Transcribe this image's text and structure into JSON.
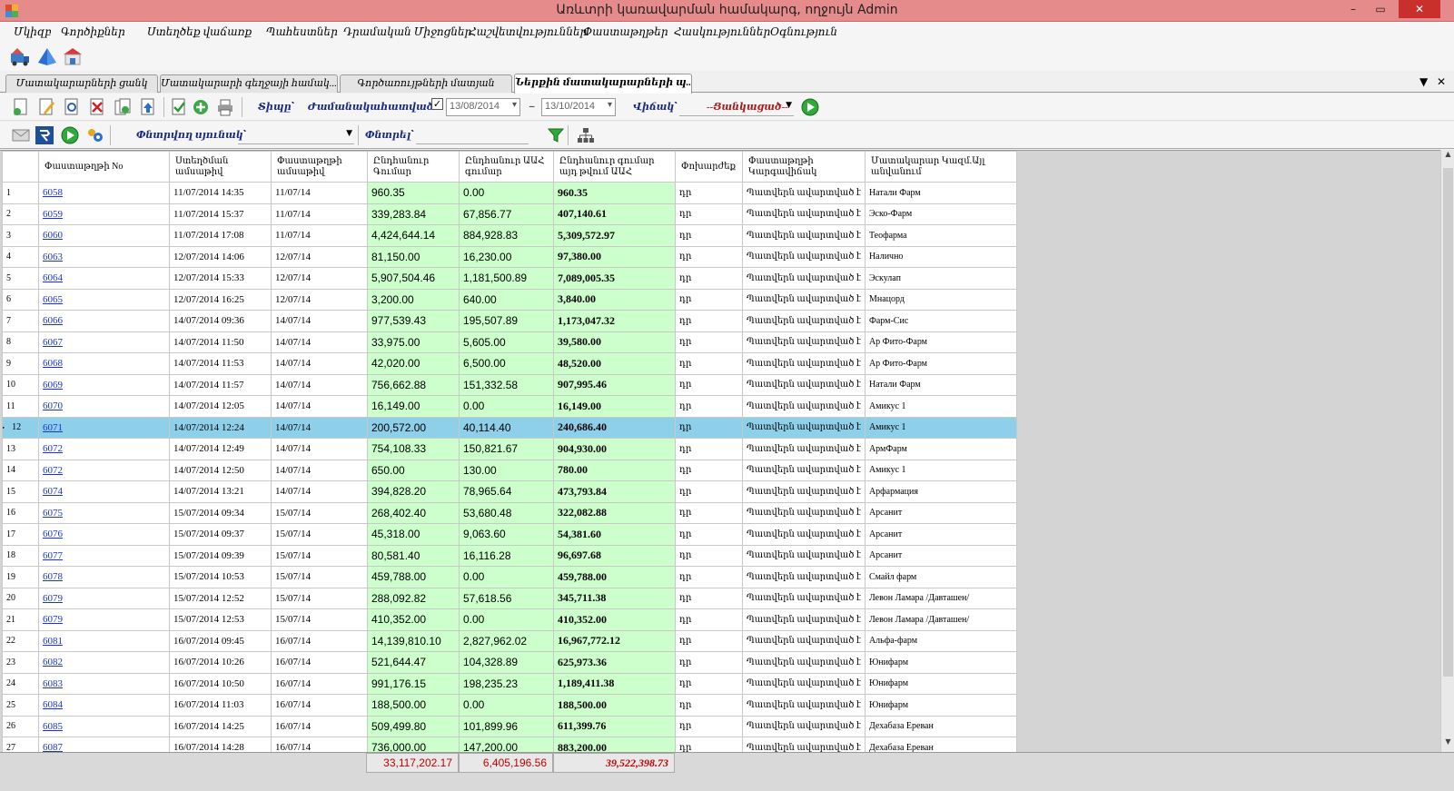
{
  "window": {
    "title": "Առևտրի կառավարման համակարգ, ողջույն Admin",
    "min": "–",
    "restore": "▭",
    "close": "✕"
  },
  "menu": [
    "Մկիզբ",
    "Գործիքներ",
    "Ստեղծեք վաճառք",
    "Պահեստներ",
    "Դրամական Միջոցներ",
    "Հաշվետվություններ",
    "Փաստաթղթեր",
    "Հասկություններ",
    "Օգնություն"
  ],
  "tabs": [
    {
      "label": "Մատակարարների ցանկ",
      "active": false
    },
    {
      "label": "Մատակարարի գեղջայի համակ...",
      "active": false
    },
    {
      "label": "Գործառույթների մատյան",
      "active": false
    },
    {
      "label": "Ներքին մատակարարների պ...",
      "active": true
    }
  ],
  "tab_controls": {
    "menu": "▼",
    "close": "✕"
  },
  "filter": {
    "type_label": "Տիպը՝",
    "type_value": "Ժամանակահատված ˇ",
    "checkbox": "✓",
    "date_from": "13/08/2014",
    "dash": "–",
    "date_to": "13/10/2014",
    "status_label": "Վիճակ՝",
    "status_value": "--Ցանկացած--",
    "search_column_label": "Փնտրվող սյունակ՝",
    "search_label": "Փնտրել՝"
  },
  "columns": [
    "Փաստաթղթի No",
    "Ստեղծման ամսաթիվ",
    "Փաստաթղթի ամսաթիվ",
    "Ընդհանուր Գումար",
    "Ընդհանուր ԱԱՀ գումար",
    "Ընդհանուր գումար այդ թվում ԱԱՀ",
    "Փոխարժեք",
    "Փաստաթղթի Կարգավիճակ",
    "Մատակարար Կազմ.Այլ անվանում"
  ],
  "rows": [
    {
      "n": "1",
      "doc": "6058",
      "created": "11/07/2014 14:35",
      "date": "11/07/14",
      "sum": "960.35",
      "vat": "0.00",
      "total": "960.35",
      "rate": "դր",
      "status": "Պատվերն ավարտված է",
      "supplier": "Натали Фарм"
    },
    {
      "n": "2",
      "doc": "6059",
      "created": "11/07/2014 15:37",
      "date": "11/07/14",
      "sum": "339,283.84",
      "vat": "67,856.77",
      "total": "407,140.61",
      "rate": "դր",
      "status": "Պատվերն ավարտված է",
      "supplier": "Эско-Фарм"
    },
    {
      "n": "3",
      "doc": "6060",
      "created": "11/07/2014 17:08",
      "date": "11/07/14",
      "sum": "4,424,644.14",
      "vat": "884,928.83",
      "total": "5,309,572.97",
      "rate": "դր",
      "status": "Պատվերն ավարտված է",
      "supplier": "Теофарма"
    },
    {
      "n": "4",
      "doc": "6063",
      "created": "12/07/2014 14:06",
      "date": "12/07/14",
      "sum": "81,150.00",
      "vat": "16,230.00",
      "total": "97,380.00",
      "rate": "դր",
      "status": "Պատվերն ավարտված է",
      "supplier": "Налично"
    },
    {
      "n": "5",
      "doc": "6064",
      "created": "12/07/2014 15:33",
      "date": "12/07/14",
      "sum": "5,907,504.46",
      "vat": "1,181,500.89",
      "total": "7,089,005.35",
      "rate": "դր",
      "status": "Պատվերն ավարտված է",
      "supplier": "Эскулап"
    },
    {
      "n": "6",
      "doc": "6065",
      "created": "12/07/2014 16:25",
      "date": "12/07/14",
      "sum": "3,200.00",
      "vat": "640.00",
      "total": "3,840.00",
      "rate": "դր",
      "status": "Պատվերն ավարտված է",
      "supplier": "Мнацорд"
    },
    {
      "n": "7",
      "doc": "6066",
      "created": "14/07/2014 09:36",
      "date": "14/07/14",
      "sum": "977,539.43",
      "vat": "195,507.89",
      "total": "1,173,047.32",
      "rate": "դր",
      "status": "Պատվերն ավարտված է",
      "supplier": "Фарм-Сис"
    },
    {
      "n": "8",
      "doc": "6067",
      "created": "14/07/2014 11:50",
      "date": "14/07/14",
      "sum": "33,975.00",
      "vat": "5,605.00",
      "total": "39,580.00",
      "rate": "դր",
      "status": "Պատվերն ավարտված է",
      "supplier": "Ар Фито-Фарм"
    },
    {
      "n": "9",
      "doc": "6068",
      "created": "14/07/2014 11:53",
      "date": "14/07/14",
      "sum": "42,020.00",
      "vat": "6,500.00",
      "total": "48,520.00",
      "rate": "դր",
      "status": "Պատվերն ավարտված է",
      "supplier": "Ар Фито-Фарм"
    },
    {
      "n": "10",
      "doc": "6069",
      "created": "14/07/2014 11:57",
      "date": "14/07/14",
      "sum": "756,662.88",
      "vat": "151,332.58",
      "total": "907,995.46",
      "rate": "դր",
      "status": "Պատվերն ավարտված է",
      "supplier": "Натали Фарм"
    },
    {
      "n": "11",
      "doc": "6070",
      "created": "14/07/2014 12:05",
      "date": "14/07/14",
      "sum": "16,149.00",
      "vat": "0.00",
      "total": "16,149.00",
      "rate": "դր",
      "status": "Պատվերն ավարտված է",
      "supplier": "Амикус 1"
    },
    {
      "n": "12",
      "doc": "6071",
      "created": "14/07/2014 12:24",
      "date": "14/07/14",
      "sum": "200,572.00",
      "vat": "40,114.40",
      "total": "240,686.40",
      "rate": "դր",
      "status": "Պատվերն ավարտված է",
      "supplier": "Амикус 1",
      "selected": true
    },
    {
      "n": "13",
      "doc": "6072",
      "created": "14/07/2014 12:49",
      "date": "14/07/14",
      "sum": "754,108.33",
      "vat": "150,821.67",
      "total": "904,930.00",
      "rate": "դր",
      "status": "Պատվերն ավարտված է",
      "supplier": "АрмФарм"
    },
    {
      "n": "14",
      "doc": "6072",
      "created": "14/07/2014 12:50",
      "date": "14/07/14",
      "sum": "650.00",
      "vat": "130.00",
      "total": "780.00",
      "rate": "դր",
      "status": "Պատվերն ավարտված է",
      "supplier": "Амикус 1"
    },
    {
      "n": "15",
      "doc": "6074",
      "created": "14/07/2014 13:21",
      "date": "14/07/14",
      "sum": "394,828.20",
      "vat": "78,965.64",
      "total": "473,793.84",
      "rate": "դր",
      "status": "Պատվերն ավարտված է",
      "supplier": "Арфармация"
    },
    {
      "n": "16",
      "doc": "6075",
      "created": "15/07/2014 09:34",
      "date": "15/07/14",
      "sum": "268,402.40",
      "vat": "53,680.48",
      "total": "322,082.88",
      "rate": "դր",
      "status": "Պատվերն ավարտված է",
      "supplier": "Арсанит"
    },
    {
      "n": "17",
      "doc": "6076",
      "created": "15/07/2014 09:37",
      "date": "15/07/14",
      "sum": "45,318.00",
      "vat": "9,063.60",
      "total": "54,381.60",
      "rate": "դր",
      "status": "Պատվերն ավարտված է",
      "supplier": "Арсанит"
    },
    {
      "n": "18",
      "doc": "6077",
      "created": "15/07/2014 09:39",
      "date": "15/07/14",
      "sum": "80,581.40",
      "vat": "16,116.28",
      "total": "96,697.68",
      "rate": "դր",
      "status": "Պատվերն ավարտված է",
      "supplier": "Арсанит"
    },
    {
      "n": "19",
      "doc": "6078",
      "created": "15/07/2014 10:53",
      "date": "15/07/14",
      "sum": "459,788.00",
      "vat": "0.00",
      "total": "459,788.00",
      "rate": "դր",
      "status": "Պատվերն ավարտված է",
      "supplier": "Смайл фарм"
    },
    {
      "n": "20",
      "doc": "6079",
      "created": "15/07/2014 12:52",
      "date": "15/07/14",
      "sum": "288,092.82",
      "vat": "57,618.56",
      "total": "345,711.38",
      "rate": "դր",
      "status": "Պատվերն ավարտված է",
      "supplier": "Левон Ламара /Давташен/"
    },
    {
      "n": "21",
      "doc": "6079",
      "created": "15/07/2014 12:53",
      "date": "15/07/14",
      "sum": "410,352.00",
      "vat": "0.00",
      "total": "410,352.00",
      "rate": "դր",
      "status": "Պատվերն ավարտված է",
      "supplier": "Левон Ламара /Давташен/"
    },
    {
      "n": "22",
      "doc": "6081",
      "created": "16/07/2014 09:45",
      "date": "16/07/14",
      "sum": "14,139,810.10",
      "vat": "2,827,962.02",
      "total": "16,967,772.12",
      "rate": "դր",
      "status": "Պատվերն ավարտված է",
      "supplier": "Альфа-фарм"
    },
    {
      "n": "23",
      "doc": "6082",
      "created": "16/07/2014 10:26",
      "date": "16/07/14",
      "sum": "521,644.47",
      "vat": "104,328.89",
      "total": "625,973.36",
      "rate": "դր",
      "status": "Պատվերն ավարտված է",
      "supplier": "Юнифарм"
    },
    {
      "n": "24",
      "doc": "6083",
      "created": "16/07/2014 10:50",
      "date": "16/07/14",
      "sum": "991,176.15",
      "vat": "198,235.23",
      "total": "1,189,411.38",
      "rate": "դր",
      "status": "Պատվերն ավարտված է",
      "supplier": "Юнифарм"
    },
    {
      "n": "25",
      "doc": "6084",
      "created": "16/07/2014 11:03",
      "date": "16/07/14",
      "sum": "188,500.00",
      "vat": "0.00",
      "total": "188,500.00",
      "rate": "դր",
      "status": "Պատվերն ավարտված է",
      "supplier": "Юнифарм"
    },
    {
      "n": "26",
      "doc": "6085",
      "created": "16/07/2014 14:25",
      "date": "16/07/14",
      "sum": "509,499.80",
      "vat": "101,899.96",
      "total": "611,399.76",
      "rate": "դր",
      "status": "Պատվերն ավարտված է",
      "supplier": "Дехабаза Ереван"
    },
    {
      "n": "27",
      "doc": "6087",
      "created": "16/07/2014 14:28",
      "date": "16/07/14",
      "sum": "736,000.00",
      "vat": "147,200.00",
      "total": "883,200.00",
      "rate": "դր",
      "status": "Պատվերն ավարտված է",
      "supplier": "Дехабаза Ереван"
    }
  ],
  "totals": {
    "sum": "33,117,202.17",
    "vat": "6,405,196.56",
    "total": "39,522,398.73"
  },
  "colors": {
    "titlebar": "#e58b8b",
    "money_cell": "#ccffcc",
    "selected_row": "#8ecfea",
    "totals_text": "#c00000"
  }
}
